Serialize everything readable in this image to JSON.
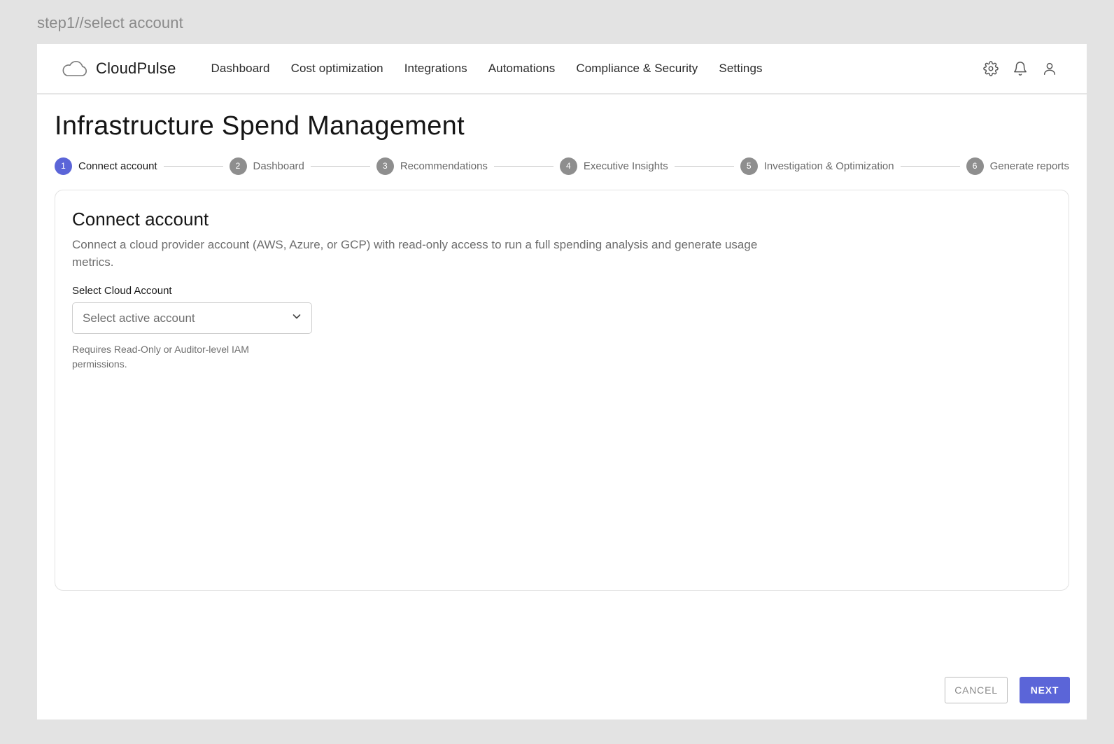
{
  "frame_label": "step1//select account",
  "brand": {
    "name": "CloudPulse",
    "icon": "cloud-icon"
  },
  "nav": {
    "items": [
      {
        "label": "Dashboard"
      },
      {
        "label": "Cost optimization"
      },
      {
        "label": "Integrations"
      },
      {
        "label": "Automations"
      },
      {
        "label": "Compliance & Security"
      },
      {
        "label": "Settings"
      }
    ],
    "icons": [
      "gear-icon",
      "bell-icon",
      "user-icon"
    ]
  },
  "page": {
    "title": "Infrastructure Spend Management"
  },
  "stepper": {
    "active_step": 1,
    "steps": [
      {
        "number": "1",
        "label": "Connect account"
      },
      {
        "number": "2",
        "label": "Dashboard"
      },
      {
        "number": "3",
        "label": "Recommendations"
      },
      {
        "number": "4",
        "label": "Executive Insights"
      },
      {
        "number": "5",
        "label": "Investigation & Optimization"
      },
      {
        "number": "6",
        "label": "Generate reports"
      }
    ]
  },
  "card": {
    "title": "Connect account",
    "description": "Connect a cloud provider account (AWS, Azure, or GCP) with read-only access to run a full spending analysis and generate usage metrics.",
    "field_label": "Select Cloud Account",
    "select_placeholder": "Select active account",
    "helper": "Requires Read-Only or Auditor-level IAM permissions."
  },
  "footer": {
    "cancel_label": "CANCEL",
    "next_label": "NEXT"
  },
  "colors": {
    "accent": "#5b65d8",
    "inactive_step": "#8e8e8e",
    "background": "#e3e3e3"
  }
}
